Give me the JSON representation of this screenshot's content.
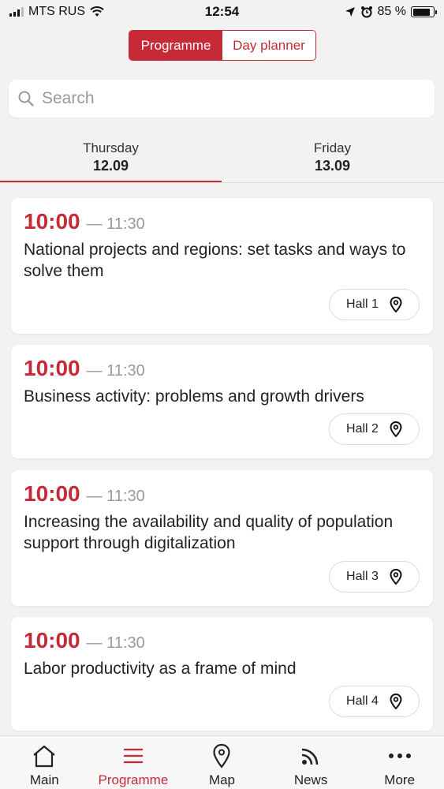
{
  "status_bar": {
    "carrier": "MTS RUS",
    "time": "12:54",
    "battery": "85 %",
    "battery_level": 0.85
  },
  "segmented": {
    "programme": "Programme",
    "day_planner": "Day planner"
  },
  "search": {
    "placeholder": "Search"
  },
  "day_tabs": [
    {
      "day": "Thursday",
      "date": "12.09"
    },
    {
      "day": "Friday",
      "date": "13.09"
    }
  ],
  "sessions": [
    {
      "start": "10:00",
      "end": "— 11:30",
      "title": "National projects and regions: set tasks and ways to solve them",
      "hall": "Hall 1"
    },
    {
      "start": "10:00",
      "end": "— 11:30",
      "title": "Business activity: problems and growth drivers",
      "hall": "Hall 2"
    },
    {
      "start": "10:00",
      "end": "— 11:30",
      "title": "Increasing the availability and quality of population support through digitalization",
      "hall": "Hall 3"
    },
    {
      "start": "10:00",
      "end": "— 11:30",
      "title": "Labor productivity as a frame of mind",
      "hall": "Hall 4"
    }
  ],
  "bottom_nav": [
    {
      "label": "Main",
      "icon": "home-icon"
    },
    {
      "label": "Programme",
      "icon": "menu-icon"
    },
    {
      "label": "Map",
      "icon": "location-pin-icon"
    },
    {
      "label": "News",
      "icon": "rss-icon"
    },
    {
      "label": "More",
      "icon": "more-dots-icon"
    }
  ],
  "colors": {
    "accent": "#c62a36",
    "background": "#f2f2f2"
  }
}
